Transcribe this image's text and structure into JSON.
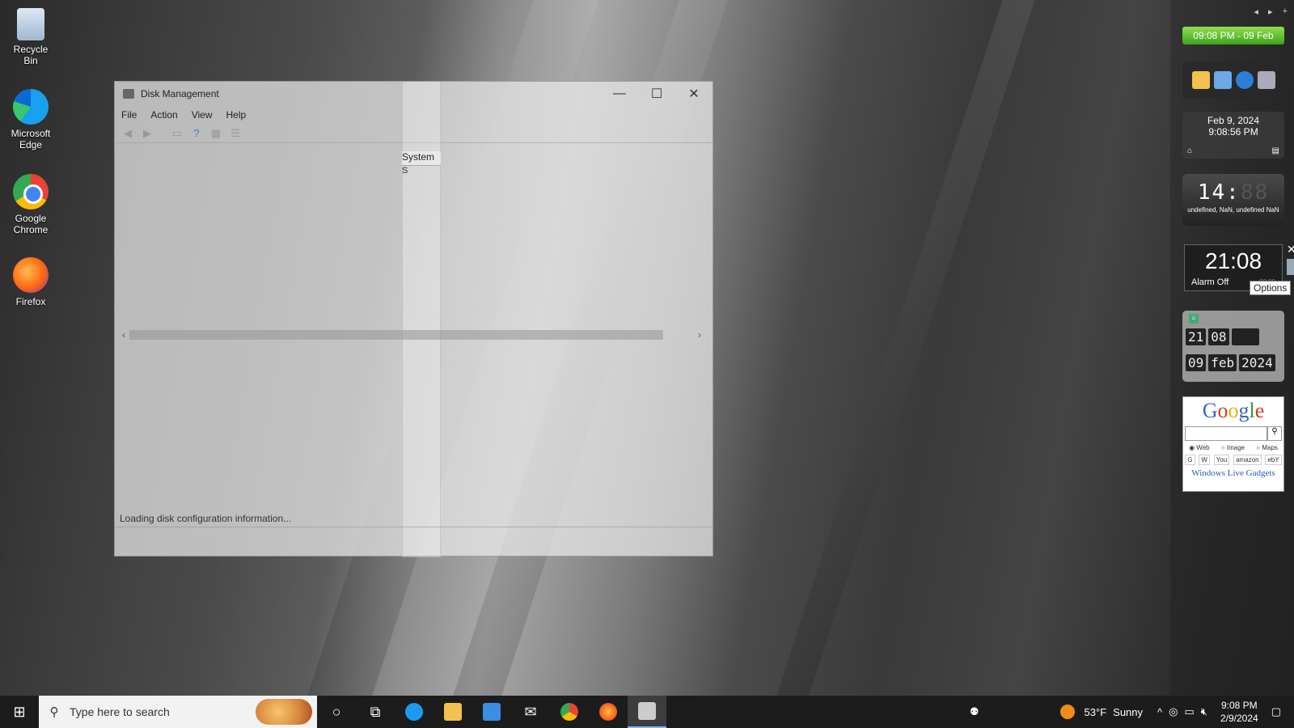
{
  "desktop": {
    "icons": [
      {
        "label": "Recycle Bin",
        "icon": "recycle-bin-icon"
      },
      {
        "label": "Microsoft Edge",
        "icon": "edge-icon"
      },
      {
        "label": "Google Chrome",
        "icon": "chrome-icon"
      },
      {
        "label": "Firefox",
        "icon": "firefox-icon"
      }
    ]
  },
  "window": {
    "title": "Disk Management",
    "minimize": "—",
    "maximize": "☐",
    "close": "✕",
    "menu": [
      "File",
      "Action",
      "View",
      "Help"
    ],
    "column_header": "System",
    "column_cell": "S",
    "scroll_left": "‹",
    "scroll_right": "›",
    "status": "Loading disk configuration information..."
  },
  "sidebar": {
    "nav_prev": "◂",
    "nav_next": "▸",
    "nav_add": "+",
    "time_banner": "09:08 PM - 09 Feb",
    "date_gadget": {
      "date": "Feb 9, 2024",
      "time": "9:08:56 PM"
    },
    "lcd_gadget": {
      "digits": "14:",
      "dim_digits": "88",
      "caption": "undefined, NaN, undefined NaN"
    },
    "alarm_clock": {
      "time": "21:08",
      "alarm": "Alarm Off",
      "sub": "00:00"
    },
    "close_glyph": "✕",
    "tooltip": "Options",
    "flip_clock": {
      "hour": "21",
      "minute": "08",
      "day": "09",
      "month": "feb",
      "year": "2024"
    },
    "google_gadget": {
      "logo": [
        "G",
        "o",
        "o",
        "g",
        "l",
        "e"
      ],
      "radios": [
        "Web",
        "Image",
        "Maps"
      ],
      "sites": [
        "G",
        "W",
        "You",
        "amazon",
        "ebY"
      ],
      "footer": "Windows Live Gadgets"
    }
  },
  "taskbar": {
    "search_placeholder": "Type here to search",
    "weather": {
      "temp": "53°F",
      "condition": "Sunny"
    },
    "clock": {
      "time": "9:08 PM",
      "date": "2/9/2024"
    }
  },
  "colors": {
    "time_banner": "#5fbe2e",
    "taskbar": "#1c1c1c",
    "accent": "#7ab4ff"
  }
}
